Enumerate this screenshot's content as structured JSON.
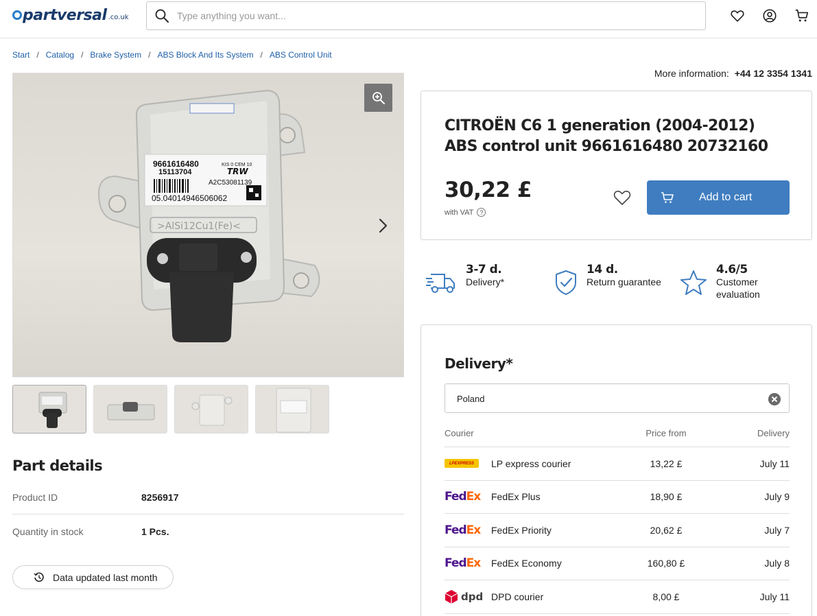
{
  "header": {
    "logo_text": "partversal",
    "logo_tld": ".co.uk",
    "search_placeholder": "Type anything you want...",
    "icons": [
      "search-icon",
      "heart-icon",
      "user-icon",
      "cart-icon"
    ]
  },
  "breadcrumb": {
    "items": [
      "Start",
      "Catalog",
      "Brake System",
      "ABS Block And Its System",
      "ABS Control Unit"
    ]
  },
  "gallery": {
    "thumbnail_count": 4,
    "label_line1": "9661616480",
    "label_line2": "15113704",
    "label_code": "A2C53081139",
    "label_kis": "KIS 0 CEM 10",
    "label_barcode_num": "05.04014946506062",
    "label_brand": "TRW",
    "cast_text": ">AlSi12Cu1(Fe)<"
  },
  "part_details": {
    "title": "Part details",
    "rows": [
      {
        "label": "Product ID",
        "value": "8256917"
      },
      {
        "label": "Quantity in stock",
        "value": "1 Pcs."
      }
    ],
    "updated_label": "Data updated last month"
  },
  "product": {
    "more_info_label": "More information:",
    "phone": "+44 12 3354 1341",
    "title": "CITROËN C6 1 generation (2004-2012) ABS control unit 9661616480 20732160",
    "price": "30,22 £",
    "vat_label": "with VAT",
    "add_to_cart": "Add to cart"
  },
  "features": [
    {
      "value": "3-7 d.",
      "label": "Delivery*",
      "icon": "truck-icon"
    },
    {
      "value": "14 d.",
      "label": "Return guarantee",
      "icon": "shield-check-icon"
    },
    {
      "value": "4.6/5",
      "label": "Customer evaluation",
      "icon": "star-icon"
    }
  ],
  "delivery": {
    "title": "Delivery*",
    "country": "Poland",
    "columns": {
      "courier": "Courier",
      "price": "Price from",
      "delivery": "Delivery"
    },
    "rows": [
      {
        "logo": "lp-express-logo",
        "logo_text": "LPEXPRESS",
        "name": "LP express courier",
        "price": "13,22 £",
        "date": "July 11"
      },
      {
        "logo": "fedex-logo",
        "name": "FedEx Plus",
        "price": "18,90 £",
        "date": "July 9"
      },
      {
        "logo": "fedex-logo",
        "name": "FedEx Priority",
        "price": "20,62 £",
        "date": "July 7"
      },
      {
        "logo": "fedex-logo",
        "name": "FedEx Economy",
        "price": "160,80 £",
        "date": "July 8"
      },
      {
        "logo": "dpd-logo",
        "logo_text": "dpd",
        "name": "DPD courier",
        "price": "8,00 £",
        "date": "July 11"
      }
    ],
    "fedex_logo_parts": [
      "Fed",
      "Ex"
    ]
  },
  "colors": {
    "accent": "#3f7dc0",
    "link": "#1f5fa8",
    "fedex_purple": "#4d148c",
    "fedex_orange": "#ff6600",
    "dpd_red": "#dc0032",
    "lp_yellow": "#f5c400"
  }
}
